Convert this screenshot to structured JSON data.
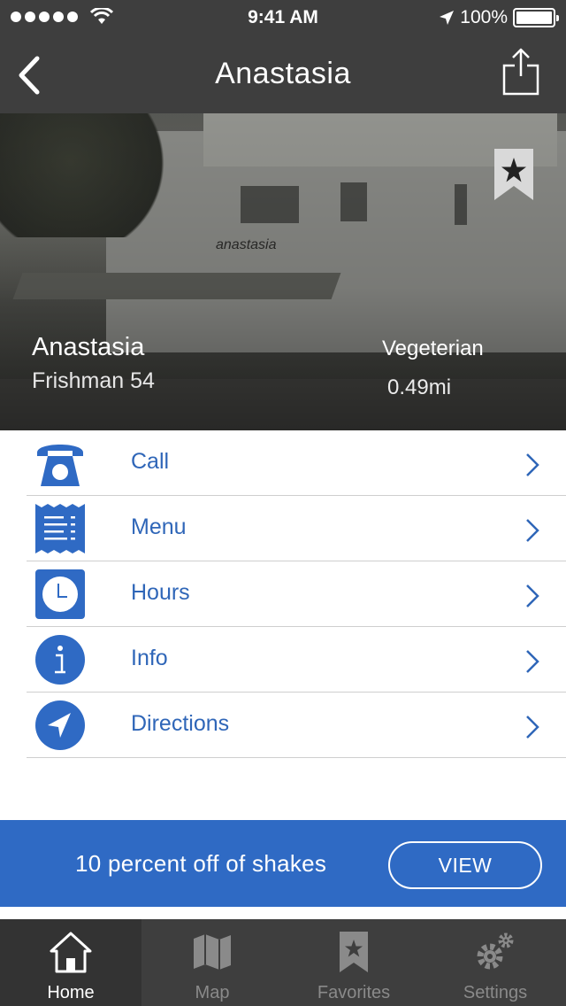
{
  "status_bar": {
    "time": "9:41 AM",
    "battery": "100%"
  },
  "nav": {
    "title": "Anastasia",
    "back_icon": "chevron-left-icon",
    "share_icon": "share-icon"
  },
  "hero": {
    "name": "Anastasia",
    "address": "Frishman 54",
    "category": "Vegeterian",
    "distance": "0.49mi",
    "sign_text": "anastasia",
    "bookmark_icon": "star-bookmark-icon"
  },
  "actions": [
    {
      "label": "Call",
      "icon": "telephone-icon"
    },
    {
      "label": "Menu",
      "icon": "menu-receipt-icon"
    },
    {
      "label": "Hours",
      "icon": "clock-icon"
    },
    {
      "label": "Info",
      "icon": "info-icon"
    },
    {
      "label": "Directions",
      "icon": "location-arrow-icon"
    }
  ],
  "promo": {
    "text": "10 percent off of shakes",
    "button_label": "VIEW"
  },
  "tabs": [
    {
      "label": "Home",
      "icon": "home-icon",
      "active": true
    },
    {
      "label": "Map",
      "icon": "map-icon",
      "active": false
    },
    {
      "label": "Favorites",
      "icon": "favorites-bookmark-icon",
      "active": false
    },
    {
      "label": "Settings",
      "icon": "gears-icon",
      "active": false
    }
  ],
  "colors": {
    "accent": "#2f6ac4",
    "bar": "#3e3e3e",
    "label": "#2f66b8"
  }
}
